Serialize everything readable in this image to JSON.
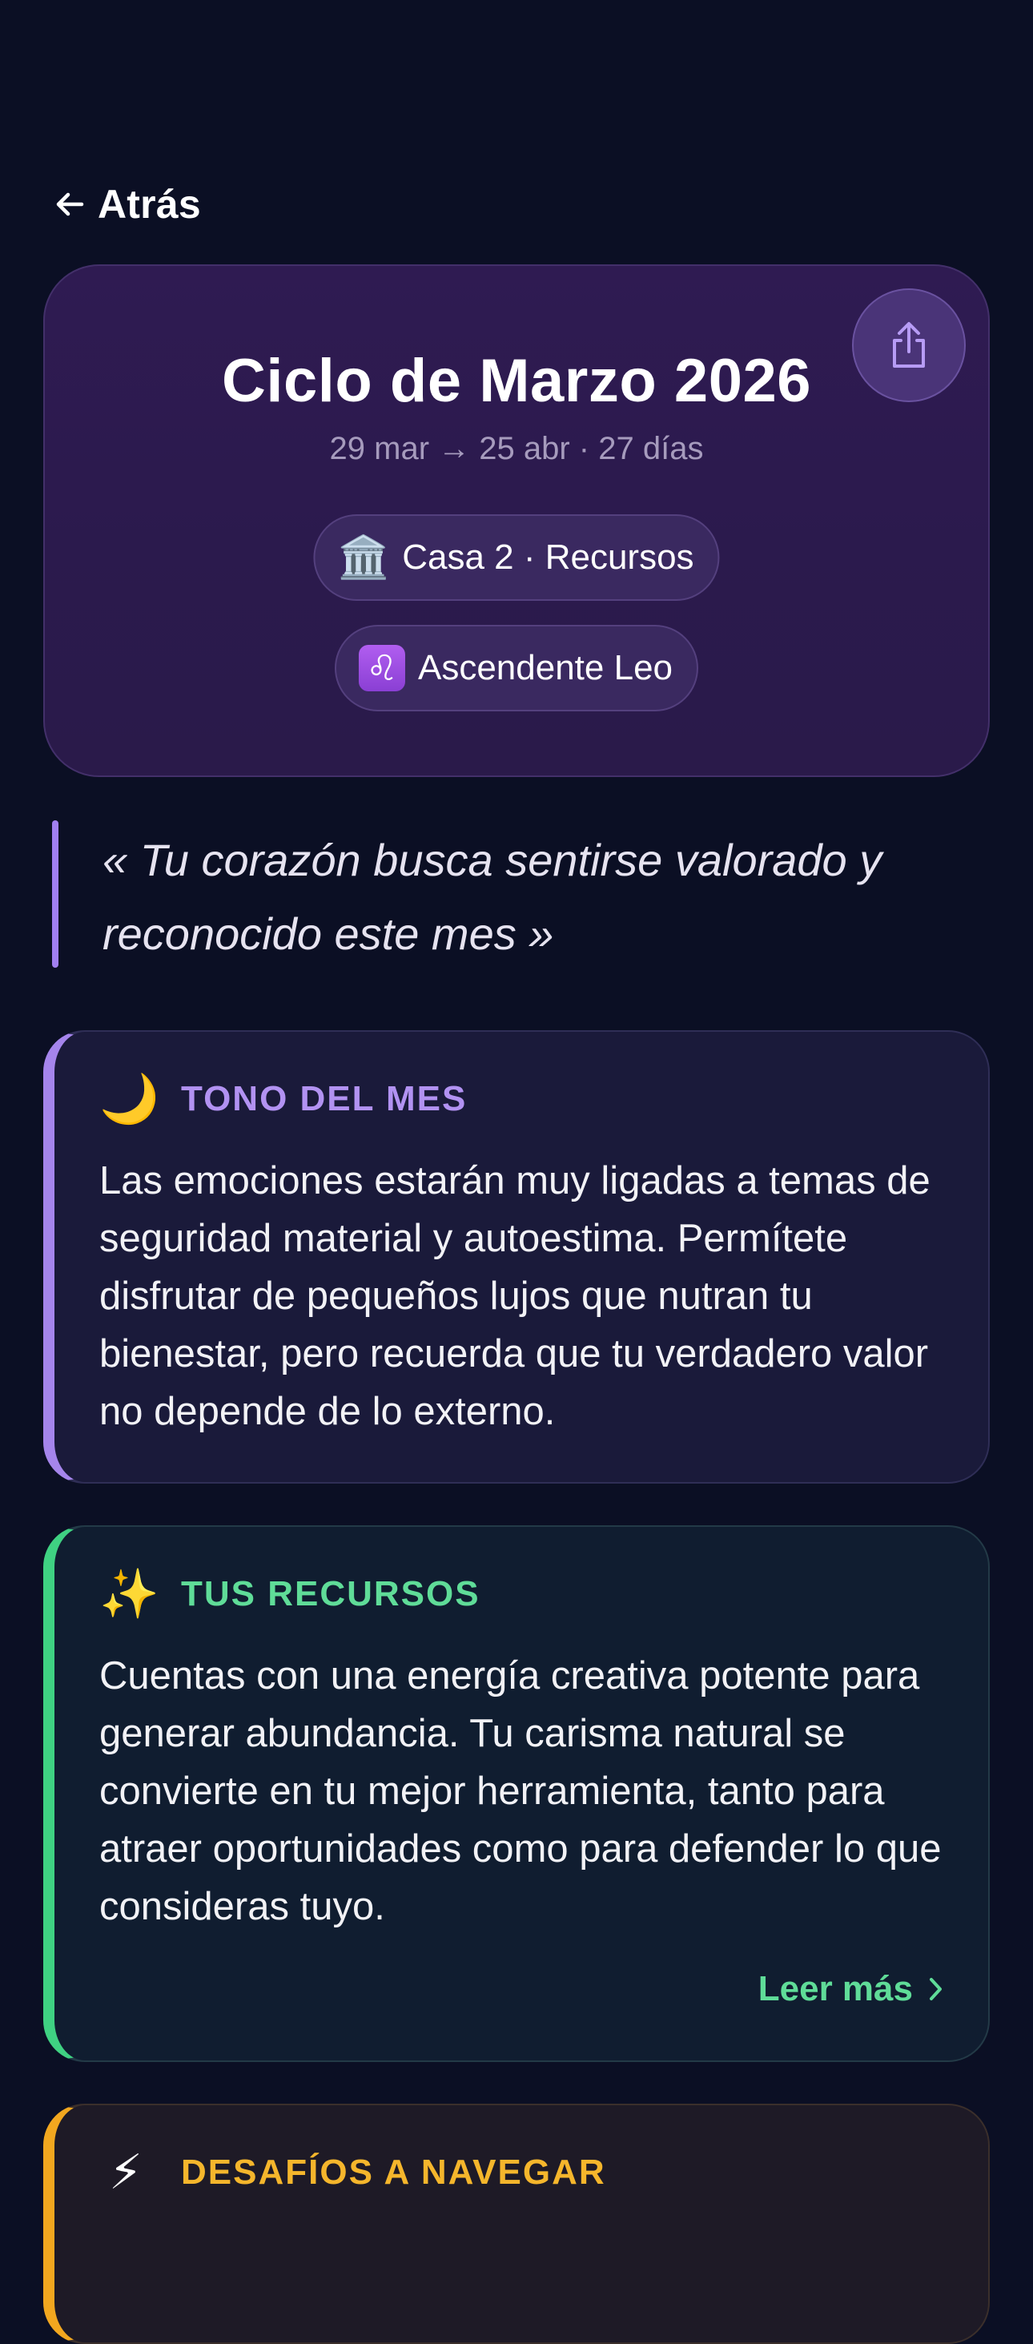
{
  "nav": {
    "back_label": "Atrás"
  },
  "header": {
    "title": "Ciclo de Marzo 2026",
    "dates": "29 mar → 25 abr · 27 días",
    "house_chip": {
      "icon": "🏛️",
      "label": "Casa 2 · Recursos"
    },
    "ascendant_chip": {
      "icon": "♌",
      "label": "Ascendente Leo"
    }
  },
  "quote": "« Tu corazón busca sentirse valorado y reconocido este mes »",
  "sections": [
    {
      "icon": "🌙",
      "title": "TONO DEL MES",
      "body": "Las emociones estarán muy ligadas a temas de seguridad material y autoestima. Permítete disfrutar de pequeños lujos que nutran tu bienestar, pero recuerda que tu verdadero valor no depende de lo externo.",
      "accent": "#a585ec"
    },
    {
      "icon": "✨",
      "title": "TUS RECURSOS",
      "body": "Cuentas con una energía creativa potente para generar abundancia. Tu carisma natural se convierte en tu mejor herramienta, tanto para atraer oportunidades como para defender lo que consideras tuyo.",
      "read_more": "Leer más",
      "accent": "#3fd182"
    },
    {
      "icon": "⚡",
      "title": "DESAFÍOS A NAVEGAR",
      "accent": "#f2a71f"
    }
  ],
  "colors": {
    "background": "#0b0f24",
    "header_card": "#2f1b52",
    "quote_accent": "#a17ff0"
  }
}
